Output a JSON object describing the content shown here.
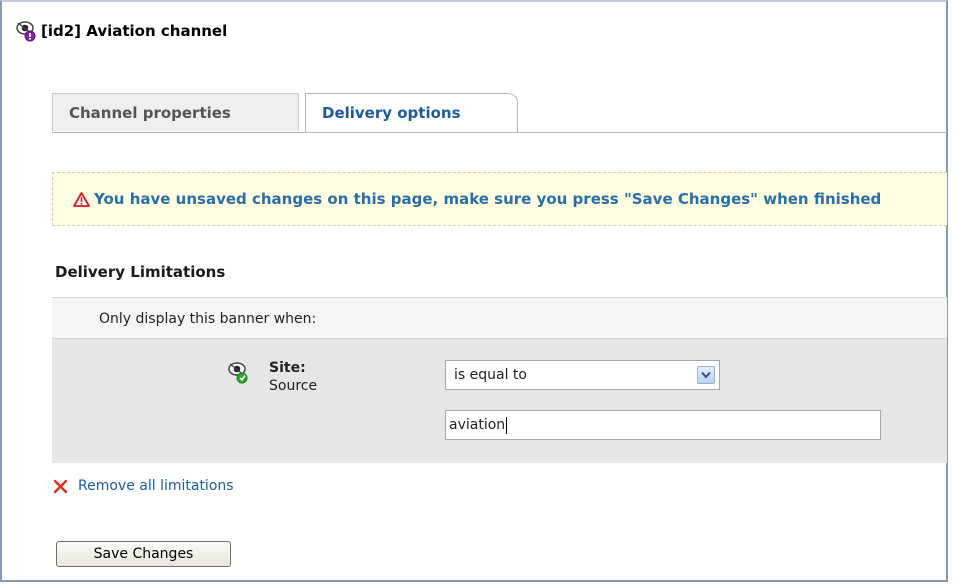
{
  "page": {
    "title": "[id2] Aviation channel"
  },
  "tabs": [
    {
      "label": "Channel properties",
      "active": false
    },
    {
      "label": "Delivery options",
      "active": true
    }
  ],
  "warning": {
    "text": "You have unsaved changes on this page, make sure you press \"Save Changes\" when finished"
  },
  "delivery": {
    "section_title": "Delivery Limitations",
    "intro": "Only display this banner when:",
    "limitation": {
      "name": "Site:",
      "subtype": "Source",
      "operator": "is equal to",
      "value": "aviation"
    },
    "remove_all_label": "Remove all limitations",
    "save_label": "Save Changes"
  },
  "icons": {
    "channel": "channel-eye-icon",
    "limitation": "site-limitation-eye-icon",
    "warning": "warning-triangle-icon",
    "remove": "remove-x-icon",
    "dropdown": "chevron-down-icon"
  },
  "colors": {
    "link_blue": "#1f5a96",
    "warning_bg": "#fffee3",
    "warning_text": "#2a6ea6",
    "limit_row_bg": "#e6e6e6",
    "remove_red": "#e0301e"
  }
}
